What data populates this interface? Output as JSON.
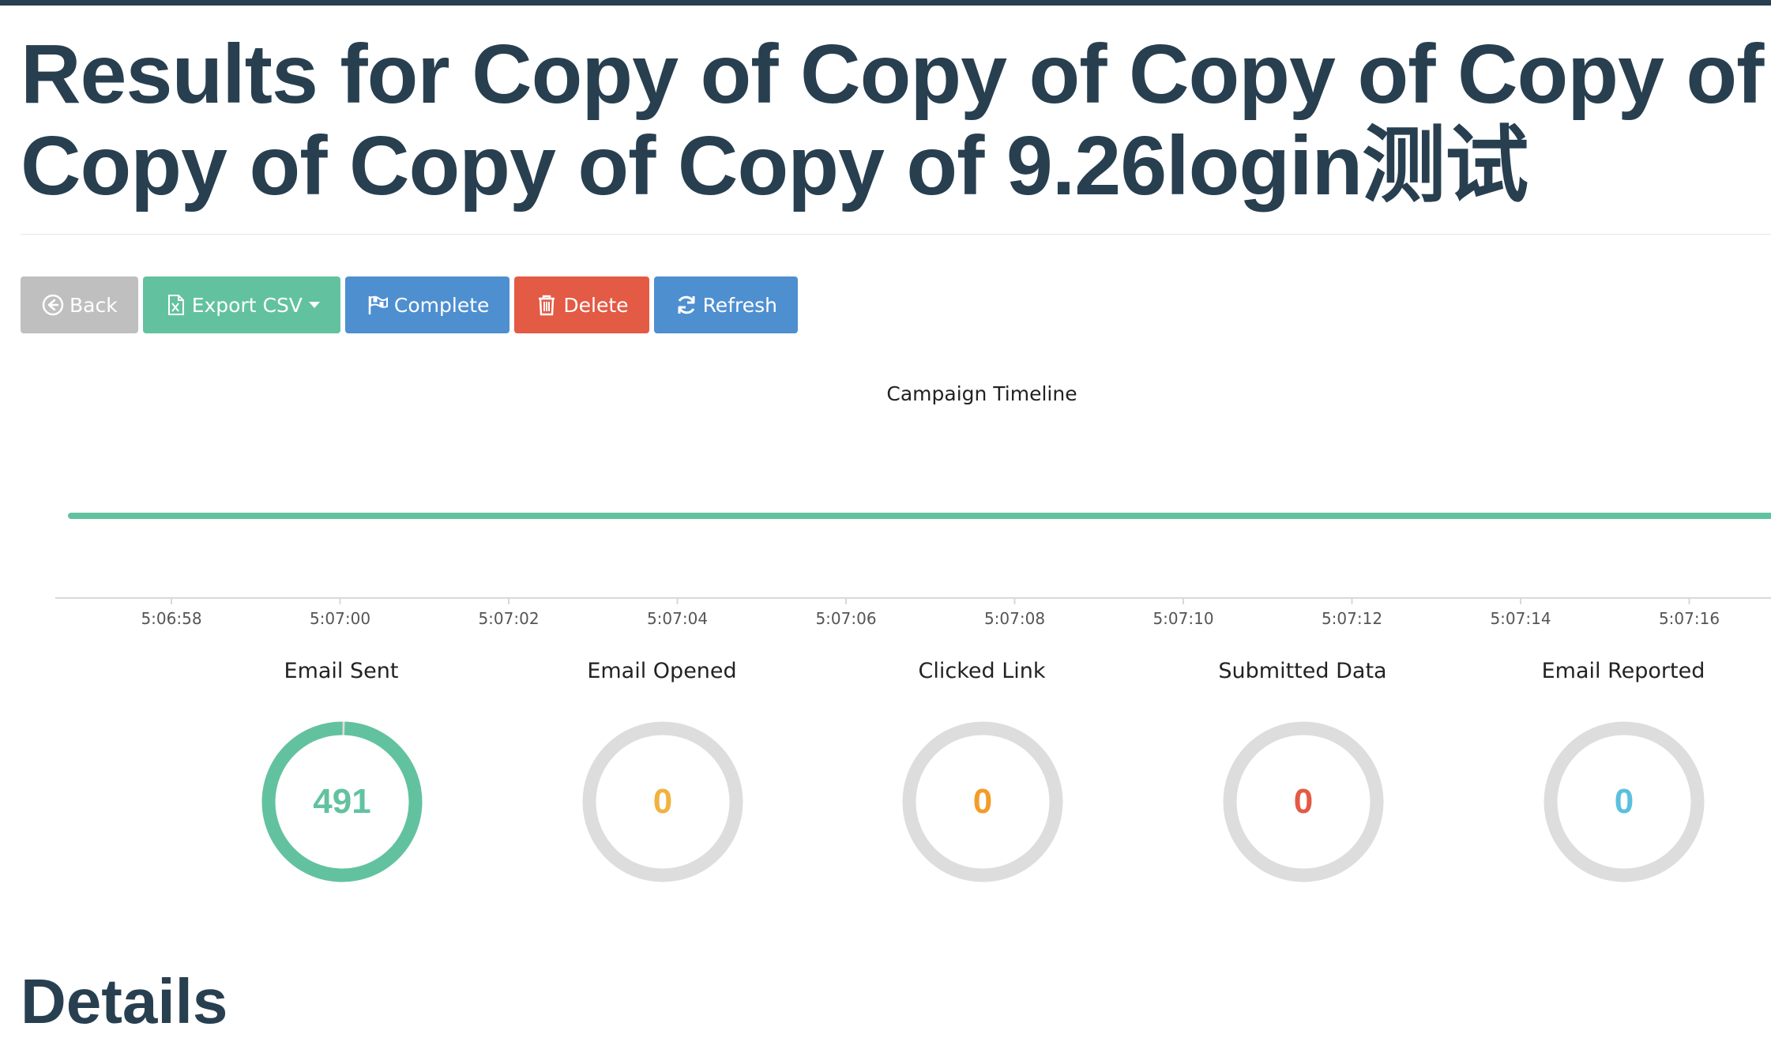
{
  "page": {
    "title": "Results for Copy of Copy of Copy of Copy of Copy of Copy of Copy of 9.26login测试",
    "details_heading": "Details"
  },
  "toolbar": {
    "back_label": "Back",
    "export_label": "Export CSV",
    "complete_label": "Complete",
    "delete_label": "Delete",
    "refresh_label": "Refresh"
  },
  "timeline": {
    "title": "Campaign Timeline",
    "series_color": "#62c2a0",
    "ticks": [
      "5:06:58",
      "5:07:00",
      "5:07:02",
      "5:07:04",
      "5:07:06",
      "5:07:08",
      "5:07:10",
      "5:07:12",
      "5:07:14",
      "5:07:16"
    ]
  },
  "stats": [
    {
      "label": "Email Sent",
      "value": "491",
      "fraction": 0.995,
      "color": "#62c2a0"
    },
    {
      "label": "Email Opened",
      "value": "0",
      "fraction": 0,
      "color": "#f0b240"
    },
    {
      "label": "Clicked Link",
      "value": "0",
      "fraction": 0,
      "color": "#f39c28"
    },
    {
      "label": "Submitted Data",
      "value": "0",
      "fraction": 0,
      "color": "#e35a45"
    },
    {
      "label": "Email Reported",
      "value": "0",
      "fraction": 0,
      "color": "#5bc0de"
    }
  ],
  "colors": {
    "title_text": "#283f50",
    "donut_track": "#dddddd",
    "btn_back": "#bfbfbf",
    "btn_export": "#62c2a0",
    "btn_complete": "#4e8fd0",
    "btn_delete": "#e35a45",
    "btn_refresh": "#4e8fd0"
  }
}
